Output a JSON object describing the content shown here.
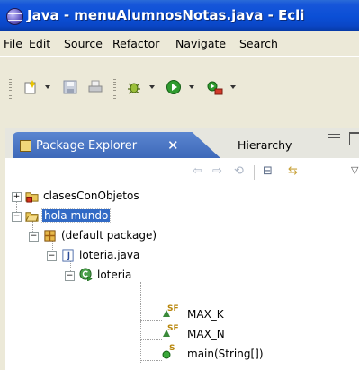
{
  "window": {
    "title": "Java - menuAlumnosNotas.java - Ecli"
  },
  "menubar": {
    "items": [
      "File",
      "Edit",
      "Source",
      "Refactor",
      "Navigate",
      "Search"
    ]
  },
  "toolbar": {
    "icons": [
      "new-wizard-icon",
      "save-icon",
      "print-icon",
      "debug-icon",
      "run-icon",
      "external-tools-icon"
    ]
  },
  "explorer": {
    "tabs": [
      {
        "label": "Package Explorer",
        "close": "✕"
      },
      {
        "label": "Hierarchy"
      }
    ],
    "nav": {
      "back": "⇦",
      "forward": "⇨",
      "up": "⟲",
      "collapse": "⊟",
      "link": "⇆",
      "menu": "▽"
    },
    "tree": [
      {
        "label": "clasesConObjetos",
        "expander": "+"
      },
      {
        "label": "hola mundo",
        "expander": "−"
      },
      {
        "label": "(default package)",
        "expander": "−"
      },
      {
        "label": "loteria.java",
        "expander": "−"
      },
      {
        "label": "loteria",
        "expander": "−"
      },
      {
        "label": "MAX_K",
        "modifiers": "SF"
      },
      {
        "label": "MAX_N",
        "modifiers": "SF"
      },
      {
        "label": "main(String[])",
        "modifiers": "S"
      }
    ]
  },
  "colors": {
    "title_bar": "#0b4fd6",
    "selection": "#316ac5",
    "chrome": "#ece9d8"
  }
}
